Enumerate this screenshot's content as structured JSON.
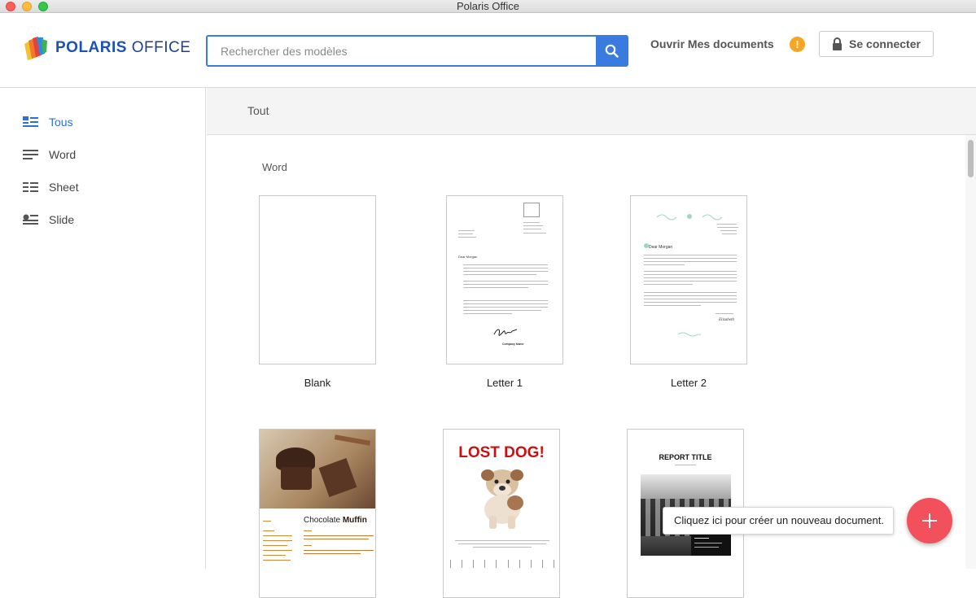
{
  "window": {
    "title": "Polaris Office"
  },
  "header": {
    "logo_text_bold": "POLARIS",
    "logo_text": " OFFICE",
    "search_placeholder": "Rechercher des modèles",
    "open_docs_label": "Ouvrir Mes documents",
    "warning_symbol": "!",
    "login_label": "Se connecter"
  },
  "sidebar": {
    "items": [
      {
        "label": "Tous",
        "icon": "all-icon",
        "active": true
      },
      {
        "label": "Word",
        "icon": "word-icon",
        "active": false
      },
      {
        "label": "Sheet",
        "icon": "sheet-icon",
        "active": false
      },
      {
        "label": "Slide",
        "icon": "slide-icon",
        "active": false
      }
    ]
  },
  "main": {
    "filter_label": "Tout",
    "section_label": "Word",
    "templates": [
      {
        "name": "Blank"
      },
      {
        "name": "Letter 1",
        "greeting": "Dear Morgan",
        "sign": "Company Name"
      },
      {
        "name": "Letter 2",
        "greeting": "Dear Morgan",
        "sign": "Elizabeth"
      },
      {
        "title_plain": "Chocolate ",
        "title_bold": "Muffin"
      },
      {
        "title": "LOST DOG!"
      },
      {
        "title": "REPORT TITLE"
      }
    ]
  },
  "tooltip": {
    "text": "Cliquez ici pour créer un nouveau document."
  },
  "colors": {
    "accent": "#3a7be0",
    "fab": "#f2505d",
    "warning": "#f5a623",
    "lost_dog_red": "#cc1010"
  }
}
